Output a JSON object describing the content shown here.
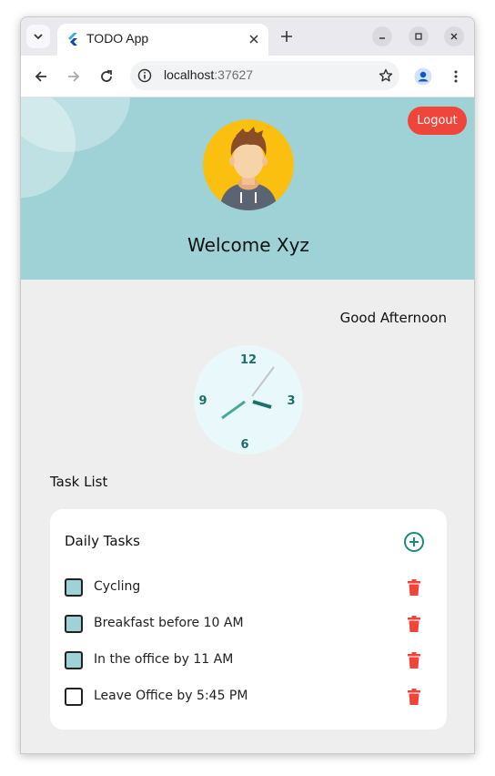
{
  "browser": {
    "tab_title": "TODO App",
    "url_host": "localhost",
    "url_port": ":37627"
  },
  "app": {
    "logout_label": "Logout",
    "welcome_text": "Welcome Xyz",
    "greeting": "Good Afternoon",
    "clock_numbers": {
      "twelve": "12",
      "three": "3",
      "six": "6",
      "nine": "9"
    },
    "task_list_heading": "Task List",
    "card_title": "Daily Tasks",
    "tasks": [
      {
        "label": "Cycling",
        "checked": true
      },
      {
        "label": "Breakfast before 10 AM",
        "checked": true
      },
      {
        "label": "In the office by 11 AM",
        "checked": true
      },
      {
        "label": "Leave Office by 5:45 PM",
        "checked": false
      }
    ]
  },
  "colors": {
    "header_bg": "#9ed2d6",
    "logout_bg": "#f0453a",
    "accent_teal": "#1d8a80",
    "delete_red": "#f0453a"
  }
}
